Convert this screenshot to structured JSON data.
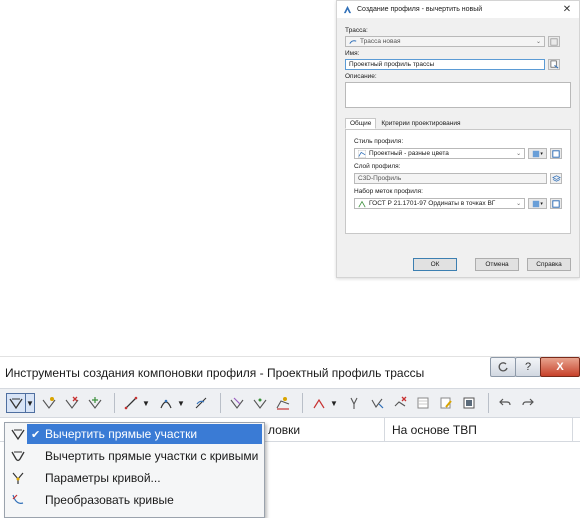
{
  "dialog": {
    "title": "Создание профиля - вычертить новый",
    "close_glyph": "✕",
    "alignment_label": "Трасса:",
    "alignment_value": "Трасса новая",
    "name_label": "Имя:",
    "name_value": "Проектный профиль трассы",
    "description_label": "Описание:",
    "tabs": [
      "Общие",
      "Критерии проектирования"
    ],
    "profile_style_label": "Стиль профиля:",
    "profile_style_value": "Проектный - разные цвета",
    "profile_layer_label": "Слой профиля:",
    "profile_layer_value": "C3D-Профиль",
    "label_set_label": "Набор меток профиля:",
    "label_set_value": "ГОСТ Р 21.1701-97 Ординаты в точках ВГ",
    "ok_label": "ОК",
    "cancel_label": "Отмена",
    "help_label": "Справка"
  },
  "toolwin": {
    "title": "Инструменты создания компоновки профиля - Проектный профиль трассы",
    "help_glyph": "?",
    "close_glyph": "X",
    "columns": [
      "ловки",
      "На основе ТВП"
    ]
  },
  "menu": {
    "items": [
      {
        "label": "Вычертить прямые участки",
        "checked": true
      },
      {
        "label": "Вычертить прямые участки с кривыми",
        "checked": false
      },
      {
        "label": "Параметры кривой...",
        "checked": false
      },
      {
        "label": "Преобразовать кривые",
        "checked": false
      }
    ],
    "check_glyph": "✔"
  },
  "colors": {
    "selection": "#3a7bd5",
    "accent_blue": "#2f6fb8",
    "icon_green": "#3a8f3a",
    "icon_red": "#c83232",
    "icon_yellow": "#d9a400"
  }
}
